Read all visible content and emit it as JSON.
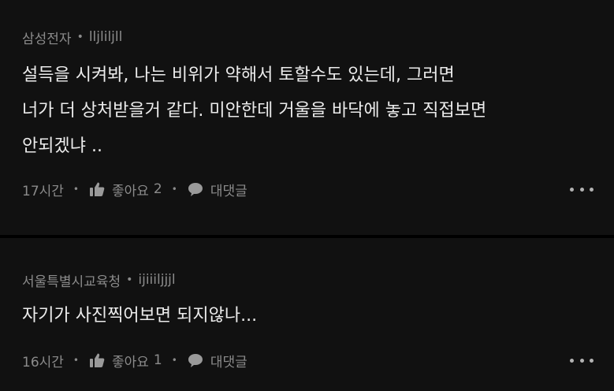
{
  "comments": [
    {
      "author": "삼성전자",
      "nickname": "lljliljll",
      "lines": [
        "설득을 시켜봐, 나는 비위가 약해서 토할수도 있는데, 그러면",
        "너가 더 상처받을거 같다. 미안한데 거울을 바닥에 놓고 직접보면",
        "안되겠냐 .."
      ],
      "time": "17시간",
      "like_label": "좋아요",
      "like_count": "2",
      "reply_label": "대댓글"
    },
    {
      "author": "서울특별시교육청",
      "nickname": "ijiiiljjjl",
      "lines": [
        "자기가 사진찍어보면 되지않나..."
      ],
      "time": "16시간",
      "like_label": "좋아요",
      "like_count": "1",
      "reply_label": "대댓글"
    }
  ],
  "icons": {
    "like": "thumbs-up-icon",
    "reply": "speech-bubble-icon",
    "more": "more-dots-icon"
  },
  "colors": {
    "background": "#000000",
    "card": "#111111",
    "body_text": "#ececec",
    "meta_text": "#8b8b8b"
  }
}
